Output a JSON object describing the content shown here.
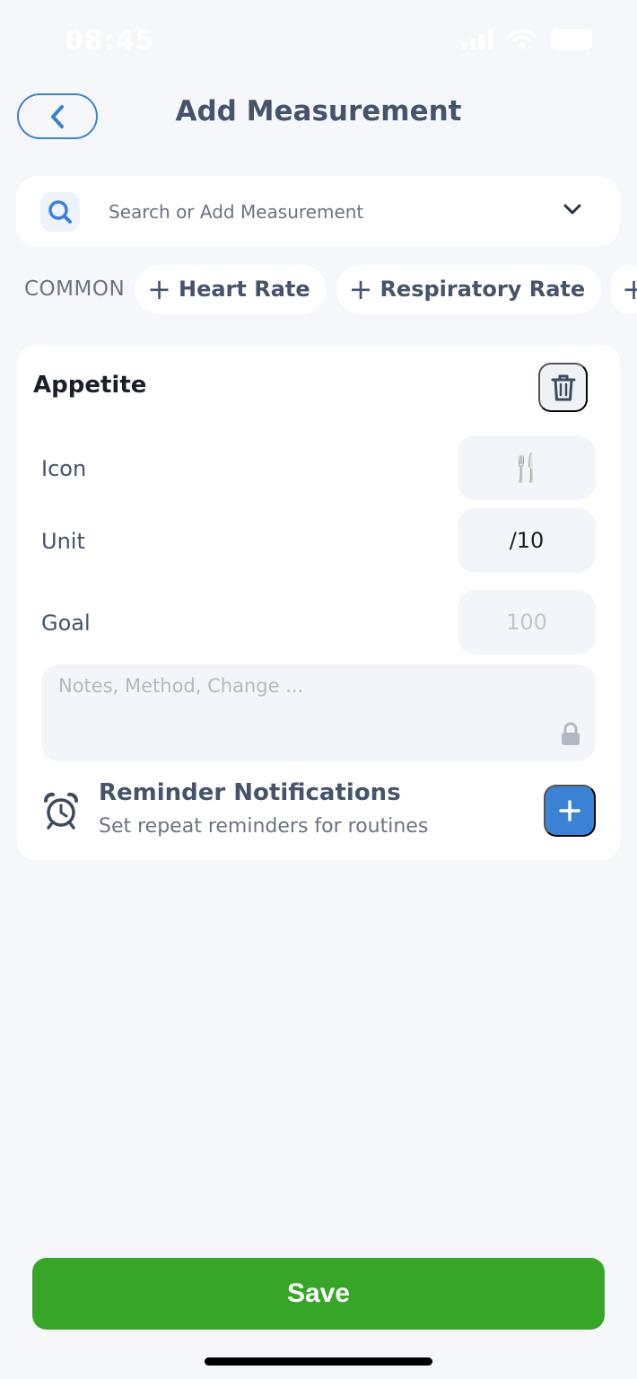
{
  "status_bar": {
    "time": "08:45",
    "battery": "71"
  },
  "header": {
    "title": "Add Measurement"
  },
  "search": {
    "placeholder": "Search or Add Measurement"
  },
  "common": {
    "label": "COMMON",
    "chips": [
      {
        "label": "Heart Rate"
      },
      {
        "label": "Respiratory Rate"
      }
    ]
  },
  "card": {
    "title": "Appetite",
    "icon_label": "Icon",
    "icon_value": "🍴",
    "unit_label": "Unit",
    "unit_value": "/10",
    "goal_label": "Goal",
    "goal_placeholder": "100",
    "notes_placeholder": "Notes, Method, Change ...",
    "reminder_title": "Reminder Notifications",
    "reminder_subtitle": "Set repeat reminders for routines"
  },
  "footer": {
    "save_label": "Save"
  },
  "colors": {
    "accent": "#3b82d6",
    "save": "#37a628",
    "background": "#f6f7fb"
  }
}
